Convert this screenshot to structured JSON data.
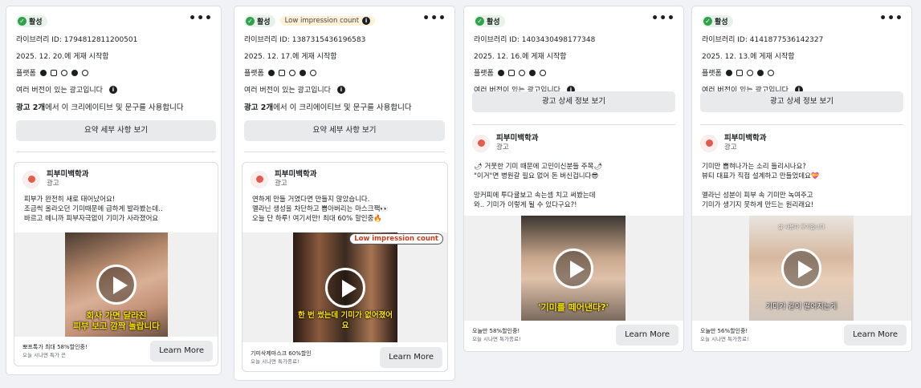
{
  "common": {
    "status": "활성",
    "more": "•••",
    "platform_label": "플랫폼",
    "multi_version": "여러 버전이 있는 광고입니다",
    "advertiser": "피부미백학과",
    "sponsored": "광고",
    "learn_more": "Learn More",
    "low_impression": "Low impression count",
    "info_icon": "i"
  },
  "cards": [
    {
      "library_id": "라이브러리 ID: 1794812811200501",
      "started": "2025. 12. 20.에 게재 시작함",
      "summary_bold": "광고 2개",
      "summary_rest": "에서 이 크리에이티브 및 문구를 사용합니다",
      "button": "요약 세부 사항 보기",
      "ad_text": "피부가 완전히 새로 태어났어요!\n조금씩 올라오던 기미때문에 급하게 발라봤는데..\n바르고 떼니까 피부자극없이 기미가 사라졌어요",
      "caption": "회사 가면 달라진\n피부 보고 깜짝 놀랍니다",
      "cta_line1": "뽀프톡가 최대 58%할인중!",
      "cta_line2": "오늘 시나면 특가 끈"
    },
    {
      "library_id": "라이브러리 ID: 1387315436196583",
      "started": "2025. 12. 17.에 게재 시작함",
      "summary_bold": "광고 2개",
      "summary_rest": "에서 이 크리에이티브 및 문구를 사용합니다",
      "button": "요약 세부 사항 보기",
      "ad_text": "연하게 만들 거였다면 만들지 않았습니다.\n멜라닌 생성을 차단하고 뽑아버리는 마스크팩👀\n오늘 단 하루! 여기서만! 최대 60% 할인중🔥",
      "caption": "한 번 썼는데 기미가 없어졌어요",
      "cta_line1": "기미삭제마스크 60%할인",
      "cta_line2": "오늘 시나면 특가종료!"
    },
    {
      "library_id": "라이브러리 ID: 1403430498177348",
      "started": "2025. 12. 16.에 게재 시작함",
      "button": "광고 상세 정보 보기",
      "ad_text": "🌶 거뭇한 기미 때문에 고민이신분들 주목🌶\n\"이거\"면 병원갈 필요 없어 돈 버신겁니다😎\n\n망커피에 투다귤보고 속는셈 치고 써봤는데\n와.. 기미가 이렇게 될 수 있다구요?!",
      "caption": "'기미를 떼어낸다?'",
      "cta_line1": "오늘만 58%할인중!",
      "cta_line2": "오늘 시나면 특가종료!"
    },
    {
      "library_id": "라이브러리 ID: 4141877536142327",
      "started": "2025. 12. 13.에 게재 시작함",
      "button": "광고 상세 정보 보기",
      "ad_text": "기미만 뽑혀나가는 소리 들리시나요?\n뷰티 대표가 직접 설계하고 만들었데요💝\n\n멜라닌 성분이 피부 속 기미만 녹여주고\n기미가 생기지 못하게 만드는 원리래요!",
      "video_text": "살 사용자 후기입니다",
      "caption": "기미가 같이 떨어지는게",
      "cta_line1": "오늘만 56%할인중!",
      "cta_line2": "오늘 시나면 특가종료!"
    }
  ]
}
